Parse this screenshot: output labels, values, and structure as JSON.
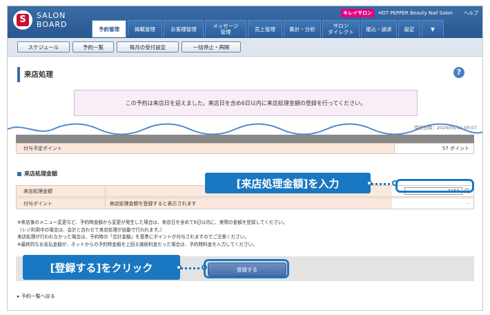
{
  "header": {
    "logo_mark": "S",
    "logo_line1": "SALON",
    "logo_line2": "BOARD",
    "brand_tag": "キレイサロン",
    "salon_name": "HOT PEPPER Beauty Nail Salon",
    "help_link": "ヘルプ"
  },
  "nav_tabs": [
    {
      "label": "予約管理",
      "active": true
    },
    {
      "label": "掲載管理"
    },
    {
      "label": "お客様管理"
    },
    {
      "label": "メッセージ\n管理"
    },
    {
      "label": "売上管理"
    },
    {
      "label": "集計・分析"
    },
    {
      "label": "サロン\nダイレクト"
    },
    {
      "label": "振込・請求"
    },
    {
      "label": "設定"
    },
    {
      "label": "▼"
    }
  ],
  "subnav": [
    "スケジュール",
    "予約一覧",
    "毎月の受付設定",
    "一括停止・再開"
  ],
  "page": {
    "title": "来店処理",
    "help_icon": "?",
    "notice": "この予約は来店日を迎えました。来店日を含め6日以内に来店処理金額の登録を行ってください。",
    "received_at": "受信日時：2024/05/11 00:07"
  },
  "points_row": {
    "label": "付与予定ポイント",
    "value": "57 ポイント"
  },
  "amount_section": {
    "heading": "来店処理金額",
    "amount_label": "来店処理金額",
    "amount_value": "3150",
    "amount_unit": "円",
    "points_label": "付与ポイント",
    "points_text": "来店処理金額を登録すると表示されます",
    "points_dash": "-"
  },
  "notes": [
    "※来店後のメニュー変更など、予約時金額から変更が発生した場合は、来店日を含めて6日以内に、実際の金額を登録してください。",
    "（レジ利用中の場合は、会計と合わせて来店処理が自動で行われます。）",
    "来店処理が行われなかった場合は、予約時の「合計金額」を基準にポイントが付与されますのでご注意ください。",
    "※最終的なお支払金額が、ネットからの予約時金額を上回る施術料金だった場合は、予約時料金を入力してください。"
  ],
  "register_button": "登録する",
  "back_link": "予約一覧へ戻る",
  "callouts": {
    "input_instruction": "[来店処理金額]を入力",
    "click_instruction": "[登録する]をクリック"
  },
  "colors": {
    "accent": "#1a78c2",
    "header": "#2a5790",
    "brand_pink": "#e4007f",
    "logo_red": "#c8102e"
  }
}
